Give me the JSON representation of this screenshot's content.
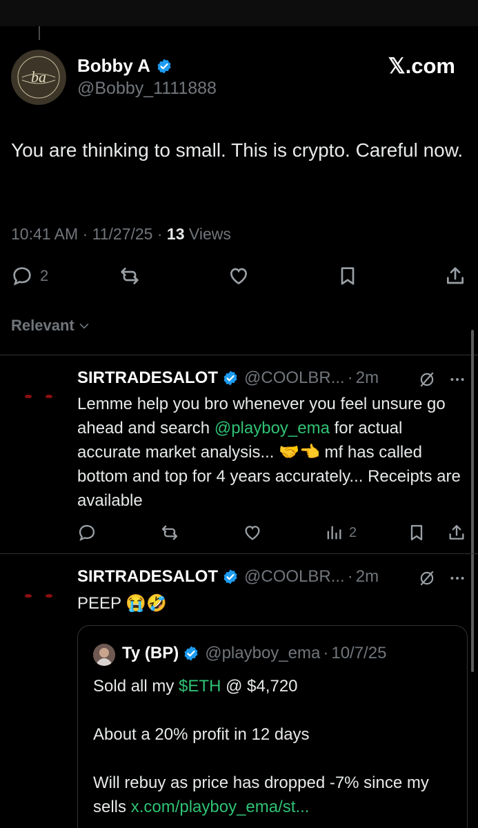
{
  "brand": "𝕏.com",
  "main_tweet": {
    "name": "Bobby A",
    "handle": "@Bobby_1111888",
    "avatar_text": "ba",
    "avatar_ring_text": "BOBBY AXE",
    "text": "You are thinking to small. This is crypto. Careful now.",
    "time": "10:41 AM",
    "date": "11/27/25",
    "views_count": "13",
    "views_label": "Views",
    "reply_count": "2"
  },
  "sort_label": "Relevant",
  "replies": [
    {
      "name": "SIRTRADESALOT",
      "handle": "@COOLBR...",
      "time": "2m",
      "text_before": "Lemme help you bro whenever you feel unsure go ahead and search ",
      "mention": "@playboy_ema",
      "text_after": " for actual accurate market analysis... 🤝👈 mf has called bottom and top for 4 years accurately... Receipts are available",
      "views_count": "2"
    },
    {
      "name": "SIRTRADESALOT",
      "handle": "@COOLBR...",
      "time": "2m",
      "text": "PEEP 😭🤣",
      "quote": {
        "name": "Ty (BP)",
        "handle": "@playboy_ema",
        "date": "10/7/25",
        "line1_before": "Sold all my ",
        "line1_ticker": "$ETH",
        "line1_after": " @ $4,720",
        "line2": "About a 20% profit in 12 days",
        "line3_before": "Will rebuy as price has dropped -7% since my sells ",
        "line3_link": "x.com/playboy_ema/st..."
      }
    }
  ],
  "colors": {
    "background": "#000000",
    "text": "#e7e9ea",
    "muted": "#71767b",
    "verified": "#1d9bf0",
    "link_green": "#2fc274",
    "divider": "#2f3336"
  }
}
